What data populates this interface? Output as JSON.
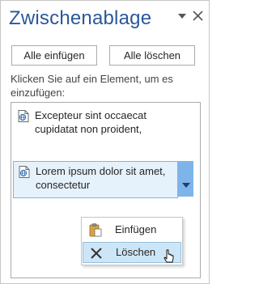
{
  "pane": {
    "title": "Zwischenablage",
    "menu_icon": "pane-options-icon",
    "close_icon": "close-icon"
  },
  "toolbar": {
    "paste_all_label": "Alle einfügen",
    "clear_all_label": "Alle löschen"
  },
  "instructions": "Klicken Sie auf ein Element, um es einzufügen:",
  "clips": [
    {
      "text": "Excepteur sint occaecat cupidatat non proident,",
      "icon": "web-clip-icon"
    },
    {
      "text": "Lorem ipsum dolor sit amet, consectetur",
      "icon": "web-clip-icon"
    }
  ],
  "context_menu": {
    "items": [
      {
        "label": "Einfügen",
        "icon": "paste-icon"
      },
      {
        "label": "Löschen",
        "icon": "delete-x-icon"
      }
    ]
  },
  "colors": {
    "title": "#2b579a",
    "selection_bg": "#e5f1fb",
    "selection_border": "#7eb4ea",
    "menu_hover": "#cde6f7"
  }
}
